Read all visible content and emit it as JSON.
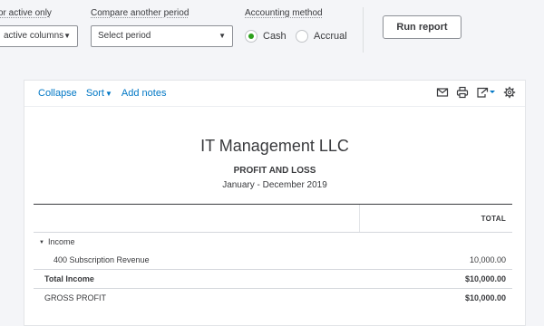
{
  "toolbar": {
    "active_filter_label": "or active only",
    "active_filter_value": "active columns",
    "compare_label": "Compare another period",
    "compare_value": "Select period",
    "accounting_label": "Accounting method",
    "cash_label": "Cash",
    "accrual_label": "Accrual",
    "selected_method": "Cash",
    "run_report_label": "Run report"
  },
  "report_actions": {
    "collapse": "Collapse",
    "sort": "Sort",
    "add_notes": "Add notes"
  },
  "report": {
    "company": "IT Management LLC",
    "title": "PROFIT AND LOSS",
    "period": "January - December 2019",
    "column_header": "TOTAL",
    "rows": [
      {
        "label": "Income",
        "amount": ""
      },
      {
        "label": "400 Subscription Revenue",
        "amount": "10,000.00"
      },
      {
        "label": "Total Income",
        "amount": "$10,000.00"
      },
      {
        "label": "GROSS PROFIT",
        "amount": "$10,000.00"
      }
    ]
  },
  "colors": {
    "link": "#0077c5",
    "radio_selected": "#2ca01c",
    "text": "#393a3d"
  }
}
